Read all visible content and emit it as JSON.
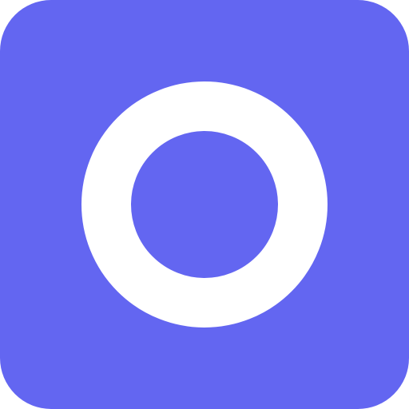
{
  "icon": {
    "name": "ring-icon",
    "background_color": "#6366f1",
    "ring_color": "#ffffff"
  }
}
